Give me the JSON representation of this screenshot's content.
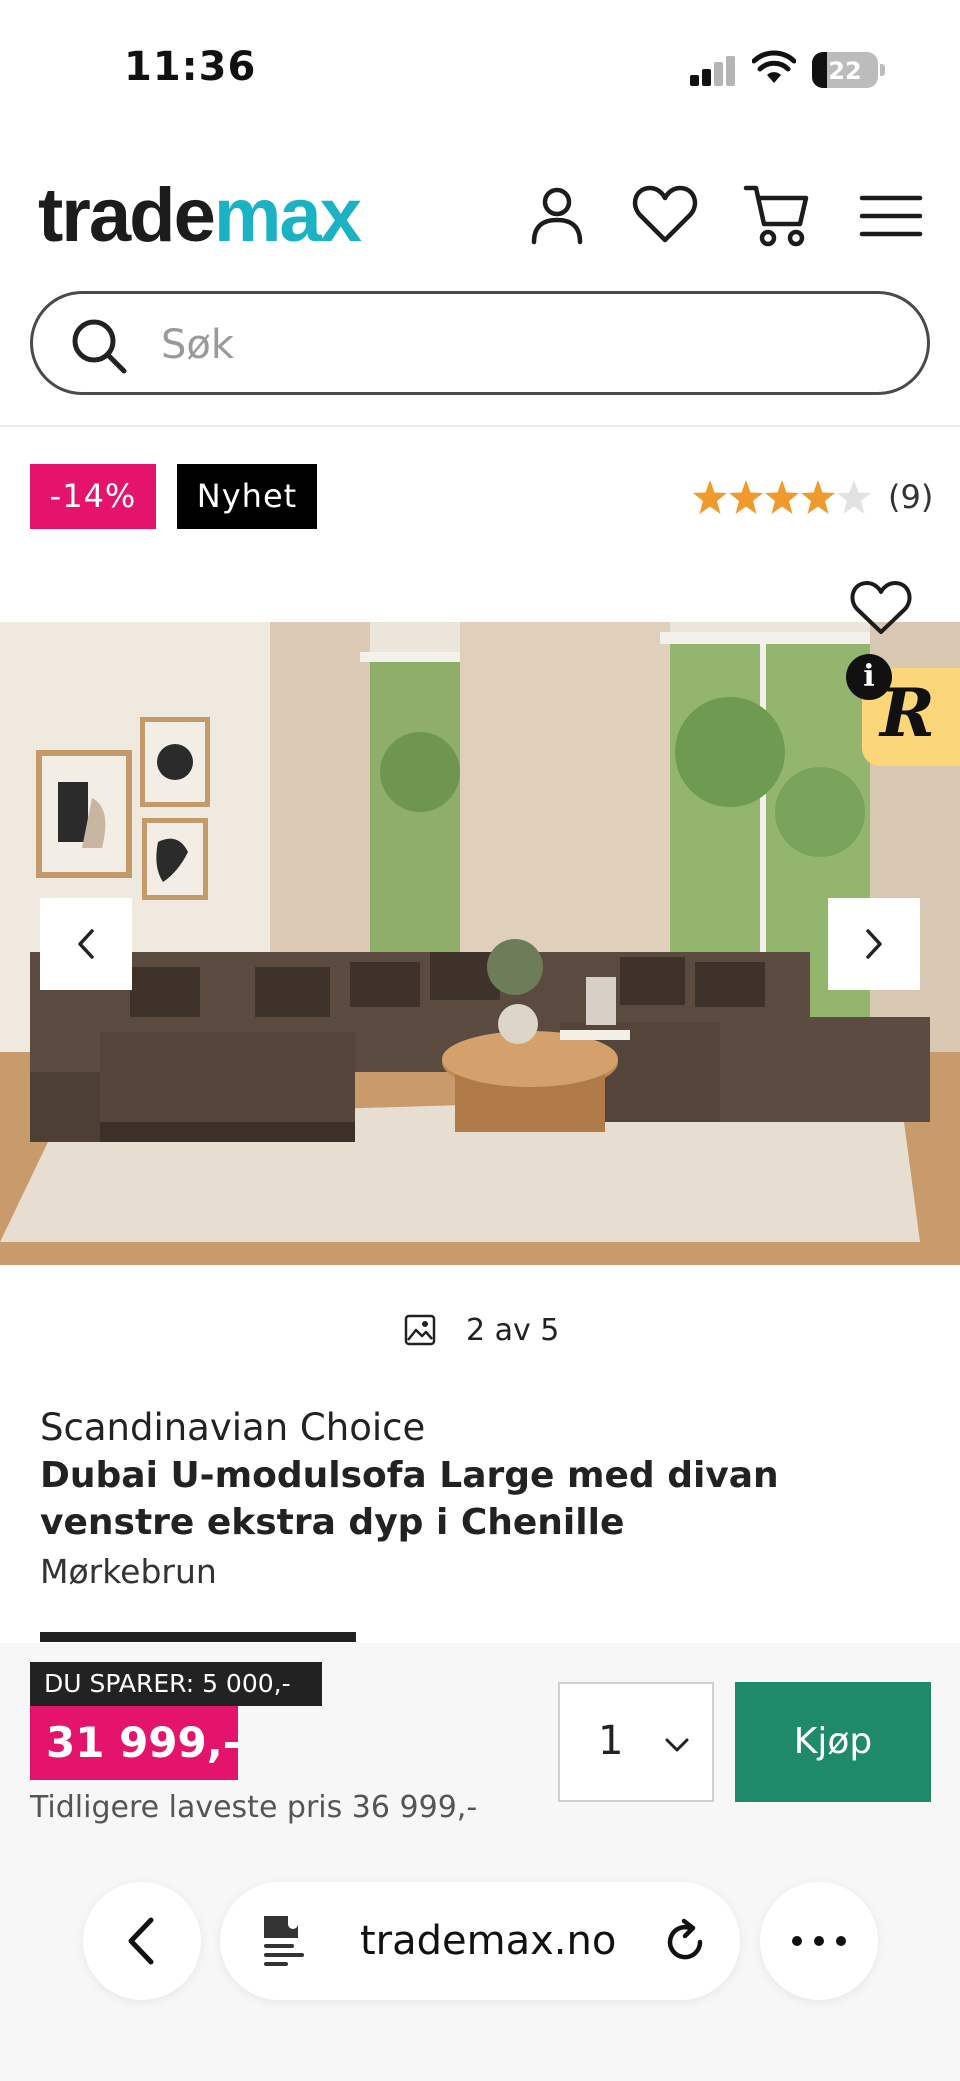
{
  "status_bar": {
    "time": "11:36",
    "battery": "22",
    "battery_level": 0.22
  },
  "header": {
    "logo_part1": "trade",
    "logo_part2": "max",
    "logo_colors": {
      "dark": "#1c1c1c",
      "accent": "#1bb3c3"
    },
    "icons": [
      "account-icon",
      "heart-icon",
      "cart-icon",
      "menu-icon"
    ]
  },
  "search": {
    "placeholder": "Søk"
  },
  "badges": {
    "discount": "-14%",
    "new": "Nyhet"
  },
  "rating": {
    "stars": 4,
    "max": 5,
    "count": "(9)",
    "star_color": "#ef9a2c"
  },
  "gallery": {
    "counter": "2 av 5"
  },
  "product": {
    "brand": "Scandinavian Choice",
    "title": "Dubai U-modulsofa Large med divan venstre ekstra dyp i Chenille",
    "variant": "Mørkebrun"
  },
  "purchase": {
    "savings": "DU SPARER: 5 000,-",
    "price": "31 999,-",
    "previous_price": "Tidligere laveste pris 36 999,-",
    "quantity": "1",
    "buy_label": "Kjøp",
    "colors": {
      "price_bg": "#e4146c",
      "buy_bg": "#1e8a6a"
    }
  },
  "browser": {
    "url": "trademax.no"
  }
}
